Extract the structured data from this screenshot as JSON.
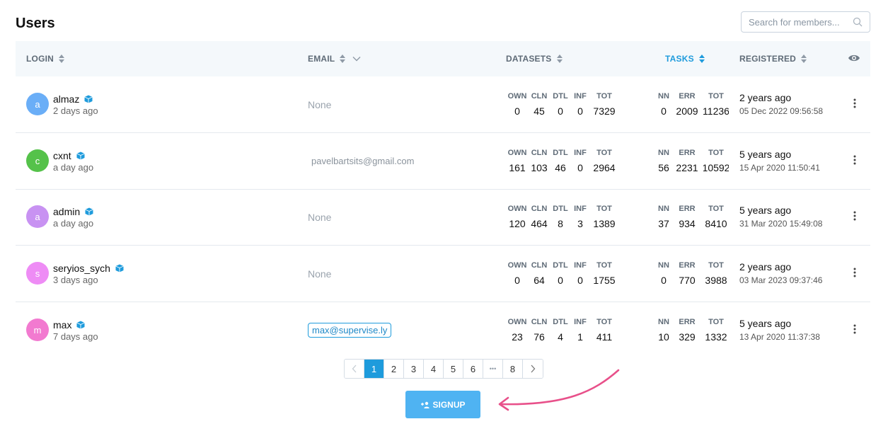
{
  "page": {
    "title": "Users"
  },
  "search": {
    "placeholder": "Search for members..."
  },
  "columns": {
    "login": "LOGIN",
    "email": "EMAIL",
    "datasets": "DATASETS",
    "tasks": "TASKS",
    "registered": "REGISTERED"
  },
  "dataset_keys": [
    "OWN",
    "CLN",
    "DTL",
    "INF",
    "TOT"
  ],
  "task_keys": [
    "NN",
    "ERR",
    "TOT"
  ],
  "users": [
    {
      "initial": "a",
      "login": "almaz",
      "last_seen": "2 days ago",
      "email": "None",
      "datasets": [
        "0",
        "45",
        "0",
        "0",
        "7329"
      ],
      "tasks": [
        "0",
        "2009",
        "11236"
      ],
      "registered_rel": "2 years ago",
      "registered_abs": "05 Dec 2022 09:56:58"
    },
    {
      "initial": "c",
      "login": "cxnt",
      "last_seen": "a day ago",
      "email": "pavelbartsits@gmail.com",
      "datasets": [
        "161",
        "103",
        "46",
        "0",
        "2964"
      ],
      "tasks": [
        "56",
        "2231",
        "10592"
      ],
      "registered_rel": "5 years ago",
      "registered_abs": "15 Apr 2020 11:50:41"
    },
    {
      "initial": "a",
      "login": "admin",
      "last_seen": "a day ago",
      "email": "None",
      "datasets": [
        "120",
        "464",
        "8",
        "3",
        "1389"
      ],
      "tasks": [
        "37",
        "934",
        "8410"
      ],
      "registered_rel": "5 years ago",
      "registered_abs": "31 Mar 2020 15:49:08"
    },
    {
      "initial": "s",
      "login": "seryios_sych",
      "last_seen": "3 days ago",
      "email": "None",
      "datasets": [
        "0",
        "64",
        "0",
        "0",
        "1755"
      ],
      "tasks": [
        "0",
        "770",
        "3988"
      ],
      "registered_rel": "2 years ago",
      "registered_abs": "03 Mar 2023 09:37:46"
    },
    {
      "initial": "m",
      "login": "max",
      "last_seen": "7 days ago",
      "email": "max@supervise.ly",
      "datasets": [
        "23",
        "76",
        "4",
        "1",
        "411"
      ],
      "tasks": [
        "10",
        "329",
        "1332"
      ],
      "registered_rel": "5 years ago",
      "registered_abs": "13 Apr 2020 11:37:38"
    }
  ],
  "pagination": {
    "pages": [
      "1",
      "2",
      "3",
      "4",
      "5",
      "6",
      "8"
    ],
    "ellipsis": "•••",
    "current": "1"
  },
  "signup": {
    "label": "SIGNUP"
  },
  "colors": {
    "accent": "#1e9bdc",
    "signup_bg": "#4fb3f2",
    "arrow": "#e8508a",
    "avatar_almaz": "#6aaef7",
    "avatar_cxnt": "#55c24a",
    "avatar_admin": "#c892f2",
    "avatar_seryios_sych": "#ee8cf5",
    "avatar_max": "#f27ad0"
  }
}
